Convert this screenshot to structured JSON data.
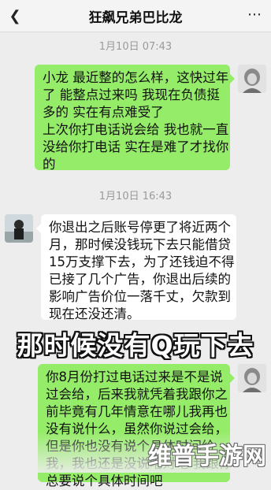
{
  "header": {
    "back_icon": "back-arrow-icon",
    "title": "狂飙兄弟巴比龙",
    "more_icon": "more-dots-icon"
  },
  "messages": [
    {
      "timestamp": "1月10日 07:43",
      "side": "right",
      "lines": [
        "小龙 最近整的怎么样，这快过年",
        "了 能整点过来吗 我现在负债挺",
        "多的 实在有点难受了",
        "上次你打电话说会给 我也就一直",
        "没给你打电话 实在是难了才找你",
        "的"
      ]
    },
    {
      "timestamp": "1月10日 16:43",
      "side": "left",
      "lines": [
        "你退出之后账号停更了将近两个",
        "月，那时候没钱玩下去只能借贷",
        "15万支撑下去，为了还钱迫不得",
        "已接了几个广告，你退出后续的",
        "影响广告价位一落千丈，欠款到",
        "现在还没还清。"
      ]
    },
    {
      "side": "right",
      "lines": [
        "你8月份打过电话过来是不是说",
        "过会给，后来我就凭着我跟你之",
        "前毕竟有几年情意在哪儿我再也",
        "没有说什么，虽然你说过会给，",
        "但是你也没有说个具体时间给",
        "我，我也还是没说啥对吧 我跟你",
        "总要说个具体时间吧"
      ]
    }
  ],
  "overlay_caption": "那时候没有Q玩下去",
  "watermark": "维普手游网"
}
